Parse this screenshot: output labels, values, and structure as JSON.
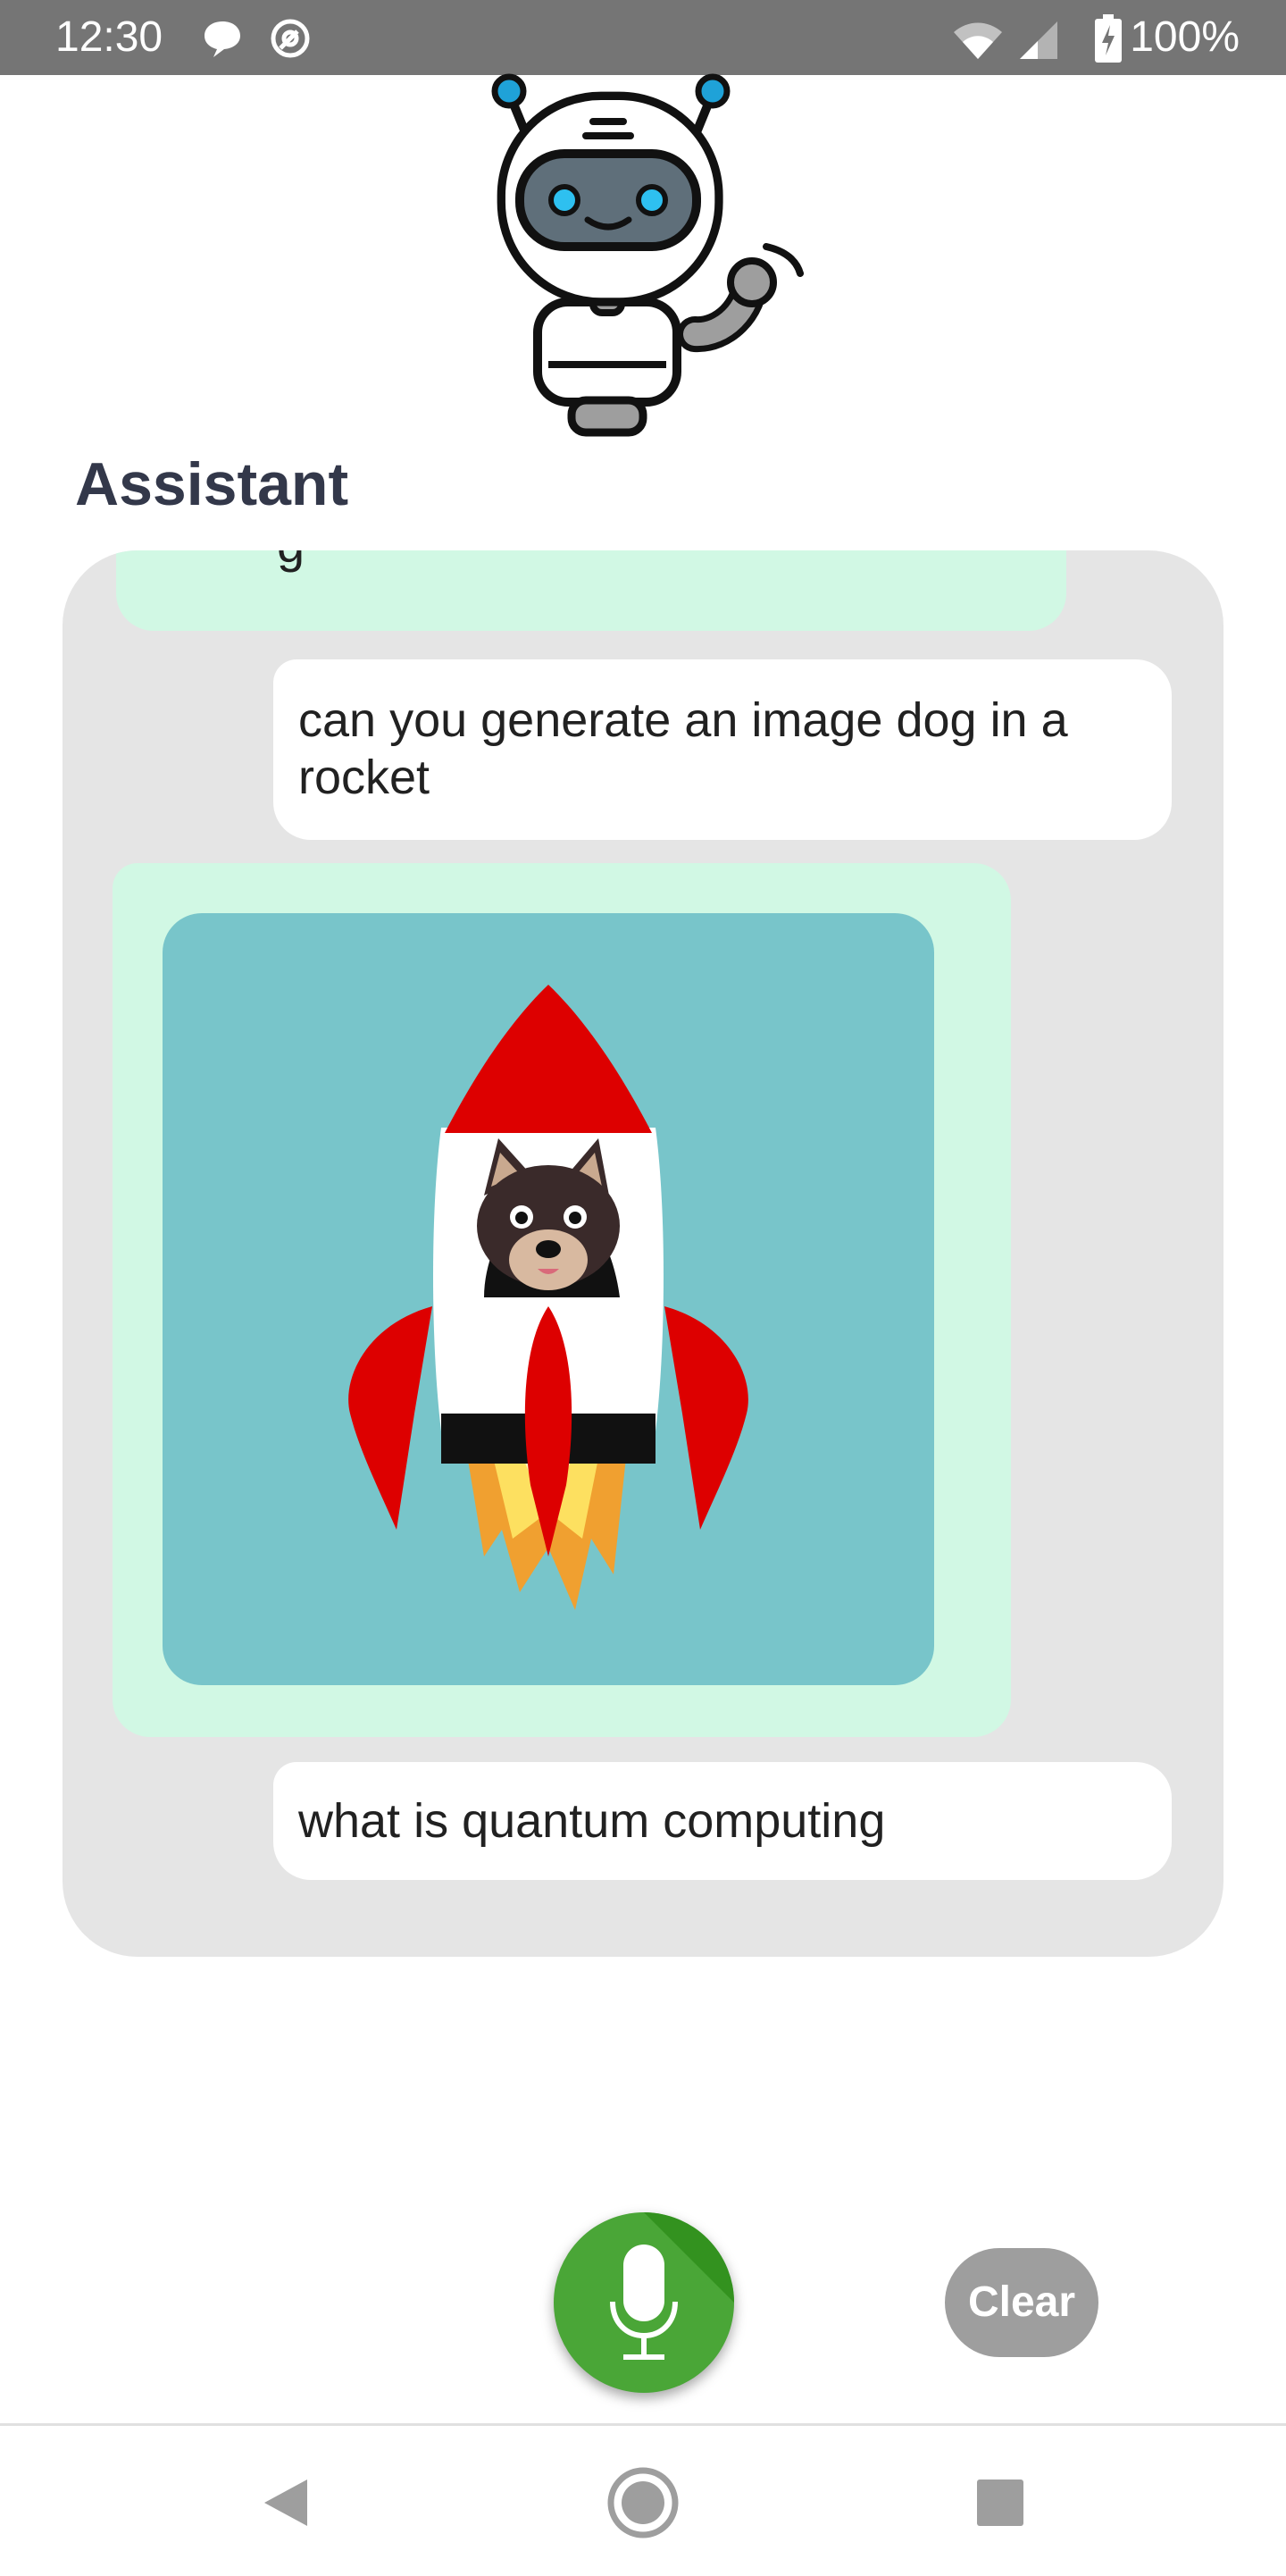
{
  "status_bar": {
    "time": "12:30",
    "battery": "100%",
    "icons": [
      "message-icon",
      "sync-icon",
      "wifi-icon",
      "signal-icon",
      "battery-charging-icon"
    ]
  },
  "assistant": {
    "title": "Assistant",
    "avatar_icon": "robot-icon"
  },
  "chat": {
    "partial_message": "g",
    "messages": [
      {
        "role": "user",
        "text": "can you generate an image dog in a rocket"
      },
      {
        "role": "assistant",
        "type": "image",
        "image_icon": "dog-in-rocket-image"
      },
      {
        "role": "user",
        "text": "what is quantum computing"
      }
    ]
  },
  "controls": {
    "mic_icon": "microphone-icon",
    "clear_label": "Clear"
  },
  "nav_bar": {
    "icons": [
      "back-icon",
      "home-icon",
      "recents-icon"
    ]
  },
  "colors": {
    "status_bar": "#757575",
    "chat_panel": "#e5e5e5",
    "assistant_bubble": "#d1f8e4",
    "user_bubble": "#ffffff",
    "mic_button": "#4aa637",
    "clear_button": "#9e9e9e",
    "image_background": "#78c5ca"
  }
}
